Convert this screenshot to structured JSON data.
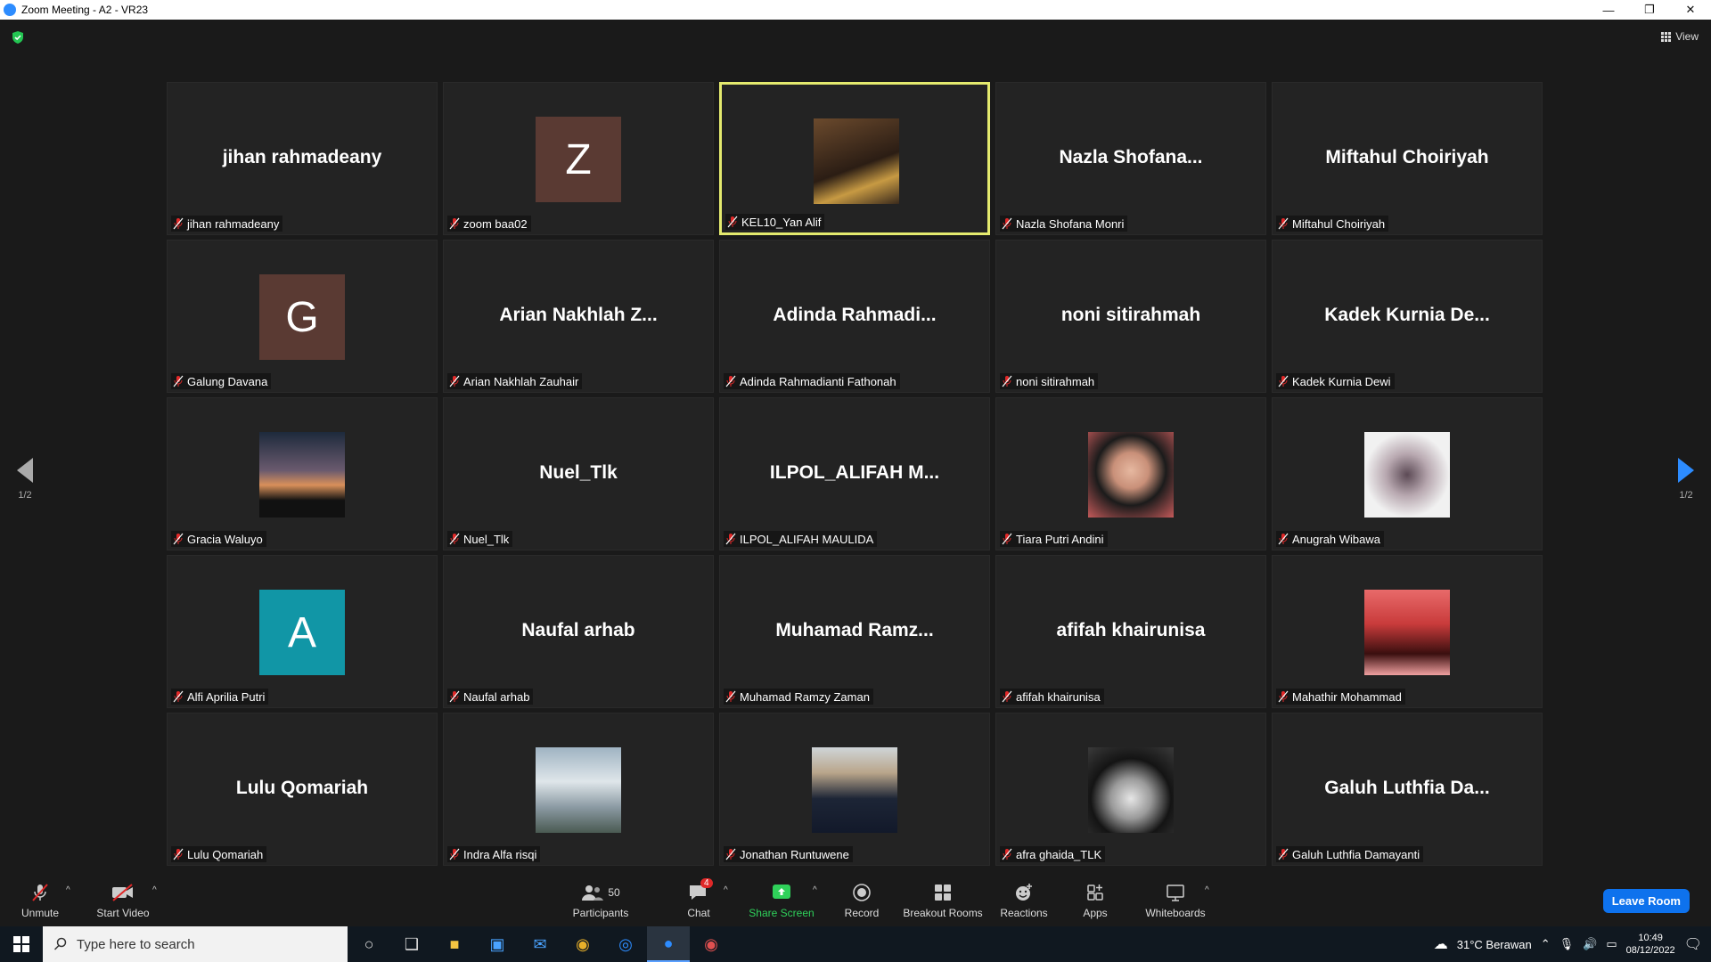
{
  "window": {
    "title": "Zoom Meeting - A2 - VR23",
    "minimize": "—",
    "restore": "❐",
    "close": "✕"
  },
  "view_label": "View",
  "pager": {
    "left": "1/2",
    "right": "1/2"
  },
  "tiles": [
    {
      "big": "jihan rahmadeany",
      "name": "jihan rahmadeany"
    },
    {
      "avatar": "Z",
      "avatar_color": "#5a3a33",
      "name": "zoom baa02"
    },
    {
      "photo": "guitarist",
      "name": "KEL10_Yan Alif",
      "active": true
    },
    {
      "big": "Nazla  Shofana...",
      "name": "Nazla Shofana Monri"
    },
    {
      "big": "Miftahul Choiriyah",
      "name": "Miftahul Choiriyah"
    },
    {
      "avatar": "G",
      "avatar_color": "#5a3a33",
      "name": "Galung Davana"
    },
    {
      "big": "Arian  Nakhlah  Z...",
      "name": "Arian Nakhlah Zauhair"
    },
    {
      "big": "Adinda  Rahmadi...",
      "name": "Adinda Rahmadianti Fathonah"
    },
    {
      "big": "noni sitirahmah",
      "name": "noni sitirahmah"
    },
    {
      "big": "Kadek  Kurnia  De...",
      "name": "Kadek Kurnia Dewi"
    },
    {
      "photo": "sunset",
      "name": "Gracia Waluyo"
    },
    {
      "big": "Nuel_Tlk",
      "name": "Nuel_Tlk"
    },
    {
      "big": "ILPOL_ALIFAH  M...",
      "name": "ILPOL_ALIFAH MAULIDA"
    },
    {
      "photo": "hijab",
      "name": "Tiara Putri Andini"
    },
    {
      "photo": "light",
      "name": "Anugrah Wibawa"
    },
    {
      "avatar": "A",
      "avatar_color": "#1196a6",
      "name": "Alfi Aprilia Putri"
    },
    {
      "big": "Naufal arhab",
      "name": "Naufal arhab"
    },
    {
      "big": "Muhamad  Ramz...",
      "name": "Muhamad Ramzy Zaman"
    },
    {
      "big": "afifah khairunisa",
      "name": "afifah khairunisa"
    },
    {
      "photo": "concert",
      "name": "Mahathir Mohammad"
    },
    {
      "big": "Lulu Qomariah",
      "name": "Lulu Qomariah"
    },
    {
      "photo": "monument",
      "name": "Indra Alfa risqi"
    },
    {
      "photo": "suit",
      "name": "Jonathan Runtuwene"
    },
    {
      "photo": "sparkle",
      "name": "afra ghaida_TLK"
    },
    {
      "big": "Galuh  Luthfia  Da...",
      "name": "Galuh Luthfia Damayanti"
    }
  ],
  "toolbar": {
    "unmute": "Unmute",
    "start_video": "Start Video",
    "participants": "Participants",
    "participants_count": "50",
    "chat": "Chat",
    "chat_badge": "4",
    "share_screen": "Share Screen",
    "record": "Record",
    "breakout": "Breakout Rooms",
    "reactions": "Reactions",
    "apps": "Apps",
    "whiteboards": "Whiteboards",
    "leave": "Leave Room",
    "caret": "^"
  },
  "taskbar": {
    "search_placeholder": "Type here to search",
    "weather": "31°C  Berawan",
    "time": "10:49",
    "date": "08/12/2022"
  },
  "colors": {
    "accent": "#0e72ed",
    "active_border": "#e4ea6e",
    "share_green": "#2fd15a",
    "mic_red": "#e02828"
  }
}
